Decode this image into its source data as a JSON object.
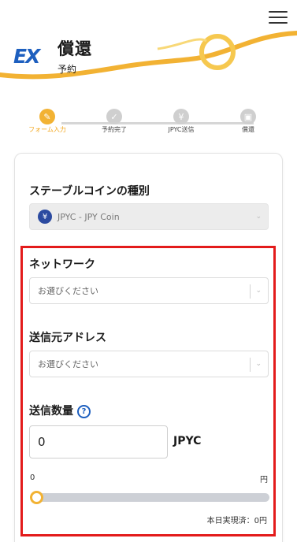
{
  "header": {
    "title": "償還",
    "subtitle": "予約",
    "logo_text": "EX",
    "menu_icon": "hamburger-icon",
    "brand_color": "#1d5fbf",
    "accent_color": "#f2b233"
  },
  "steps": [
    {
      "label": "フォーム入力",
      "icon": "pencil-icon",
      "state": "active"
    },
    {
      "label": "予約完了",
      "icon": "check-icon",
      "state": "pending"
    },
    {
      "label": "JPYC送信",
      "icon": "yen-icon",
      "state": "pending"
    },
    {
      "label": "償還",
      "icon": "wallet-icon",
      "state": "pending"
    }
  ],
  "form": {
    "coin_type": {
      "label": "ステーブルコインの種別",
      "value": "JPYC - JPY Coin",
      "icon": "yen-coin-icon"
    },
    "network": {
      "label": "ネットワーク",
      "placeholder": "お選びください"
    },
    "sender_address": {
      "label": "送信元アドレス",
      "placeholder": "お選びください"
    },
    "amount": {
      "label": "送信数量",
      "value": "0",
      "unit": "JPYC",
      "help_icon": "question-icon"
    },
    "slider": {
      "min_label": "0",
      "max_label": "円",
      "value": 0
    },
    "daily_info": "本日実現済：0円"
  }
}
